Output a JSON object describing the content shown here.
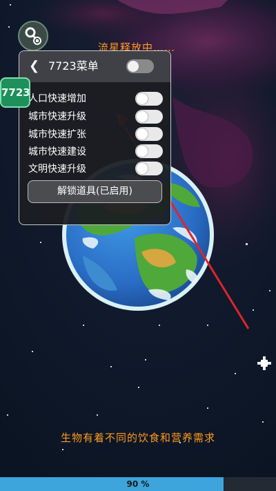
{
  "status": {
    "loading_text": "流星释放中……"
  },
  "menu": {
    "title": "7723菜单",
    "rows": [
      {
        "label": "人口快速增加"
      },
      {
        "label": "城市快速升级"
      },
      {
        "label": "城市快速扩张"
      },
      {
        "label": "城市快速建设"
      },
      {
        "label": "文明快速升级"
      }
    ],
    "unlock_button": "解锁道具(已启用)"
  },
  "floating_badge": {
    "label": "7723"
  },
  "hint": {
    "text": "生物有着不同的饮食和营养需求"
  },
  "progress": {
    "value": 0.9,
    "label": "90 %"
  },
  "icons": {
    "key_button": "key-icon",
    "back": "chevron-left-icon"
  },
  "colors": {
    "accent_orange": "#ff9a1e",
    "progress_fill": "#3da4dc",
    "annotation_arrow": "#e0242c",
    "badge_green": "#1f8f5c"
  }
}
